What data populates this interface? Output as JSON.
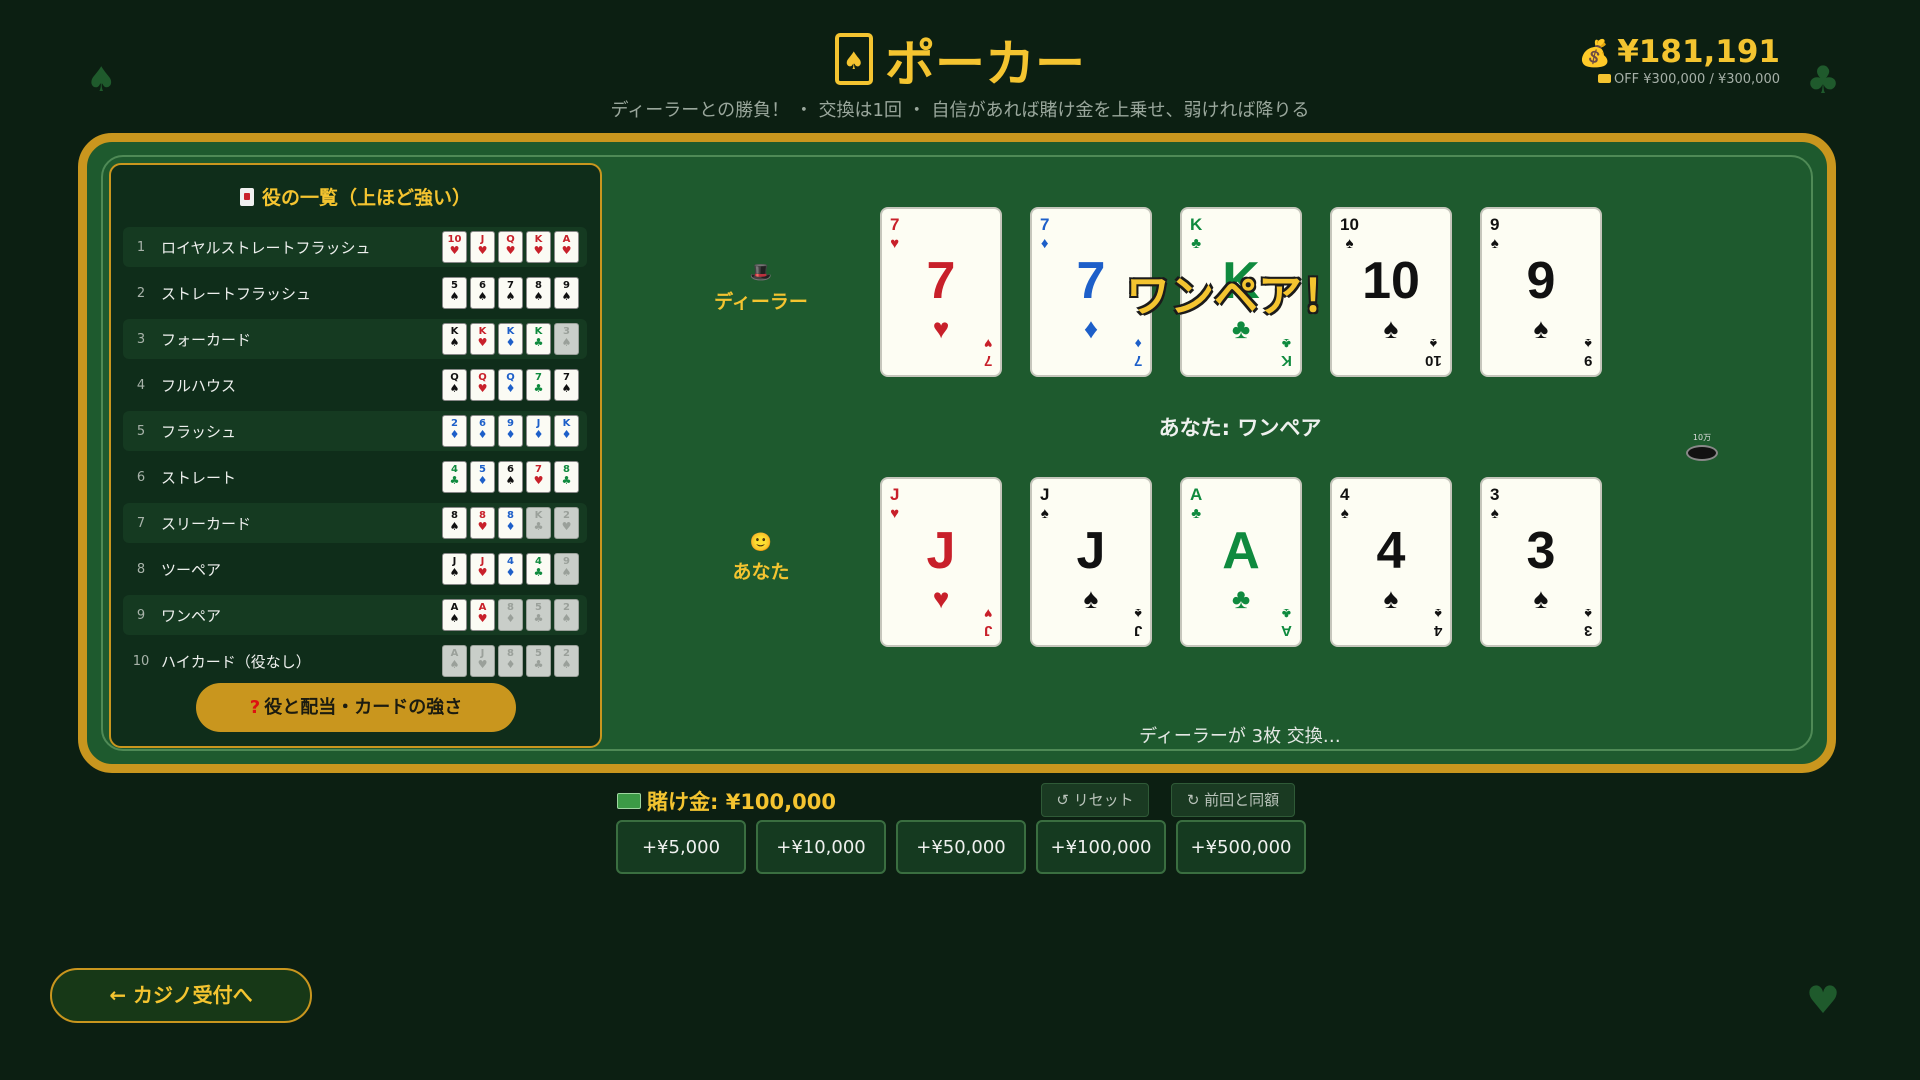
{
  "header": {
    "title": "ポーカー",
    "subtitle": "ディーラーとの勝負！ ・ 交換は1回 ・ 自信があれば賭け金を上乗せ、弱ければ降りる",
    "balance": "¥181,191",
    "limit_text": "OFF ¥300,000 / ¥300,000"
  },
  "hand_rankings": {
    "title": "役の一覧（上ほど強い）",
    "rows": [
      {
        "num": "1",
        "name": "ロイヤルストレートフラッシュ",
        "cards": [
          {
            "r": "10",
            "s": "♥",
            "c": "red"
          },
          {
            "r": "J",
            "s": "♥",
            "c": "red"
          },
          {
            "r": "Q",
            "s": "♥",
            "c": "red"
          },
          {
            "r": "K",
            "s": "♥",
            "c": "red"
          },
          {
            "r": "A",
            "s": "♥",
            "c": "red"
          }
        ]
      },
      {
        "num": "2",
        "name": "ストレートフラッシュ",
        "cards": [
          {
            "r": "5",
            "s": "♠",
            "c": "black"
          },
          {
            "r": "6",
            "s": "♠",
            "c": "black"
          },
          {
            "r": "7",
            "s": "♠",
            "c": "black"
          },
          {
            "r": "8",
            "s": "♠",
            "c": "black"
          },
          {
            "r": "9",
            "s": "♠",
            "c": "black"
          }
        ]
      },
      {
        "num": "3",
        "name": "フォーカード",
        "cards": [
          {
            "r": "K",
            "s": "♠",
            "c": "black"
          },
          {
            "r": "K",
            "s": "♥",
            "c": "red"
          },
          {
            "r": "K",
            "s": "♦",
            "c": "blue"
          },
          {
            "r": "K",
            "s": "♣",
            "c": "green"
          },
          {
            "r": "3",
            "s": "♠",
            "c": "dim"
          }
        ]
      },
      {
        "num": "4",
        "name": "フルハウス",
        "cards": [
          {
            "r": "Q",
            "s": "♠",
            "c": "black"
          },
          {
            "r": "Q",
            "s": "♥",
            "c": "red"
          },
          {
            "r": "Q",
            "s": "♦",
            "c": "blue"
          },
          {
            "r": "7",
            "s": "♣",
            "c": "green"
          },
          {
            "r": "7",
            "s": "♠",
            "c": "black"
          }
        ]
      },
      {
        "num": "5",
        "name": "フラッシュ",
        "cards": [
          {
            "r": "2",
            "s": "♦",
            "c": "blue"
          },
          {
            "r": "6",
            "s": "♦",
            "c": "blue"
          },
          {
            "r": "9",
            "s": "♦",
            "c": "blue"
          },
          {
            "r": "J",
            "s": "♦",
            "c": "blue"
          },
          {
            "r": "K",
            "s": "♦",
            "c": "blue"
          }
        ]
      },
      {
        "num": "6",
        "name": "ストレート",
        "cards": [
          {
            "r": "4",
            "s": "♣",
            "c": "green"
          },
          {
            "r": "5",
            "s": "♦",
            "c": "blue"
          },
          {
            "r": "6",
            "s": "♠",
            "c": "black"
          },
          {
            "r": "7",
            "s": "♥",
            "c": "red"
          },
          {
            "r": "8",
            "s": "♣",
            "c": "green"
          }
        ]
      },
      {
        "num": "7",
        "name": "スリーカード",
        "cards": [
          {
            "r": "8",
            "s": "♠",
            "c": "black"
          },
          {
            "r": "8",
            "s": "♥",
            "c": "red"
          },
          {
            "r": "8",
            "s": "♦",
            "c": "blue"
          },
          {
            "r": "K",
            "s": "♣",
            "c": "dim"
          },
          {
            "r": "2",
            "s": "♥",
            "c": "dim"
          }
        ]
      },
      {
        "num": "8",
        "name": "ツーペア",
        "cards": [
          {
            "r": "J",
            "s": "♠",
            "c": "black"
          },
          {
            "r": "J",
            "s": "♥",
            "c": "red"
          },
          {
            "r": "4",
            "s": "♦",
            "c": "blue"
          },
          {
            "r": "4",
            "s": "♣",
            "c": "green"
          },
          {
            "r": "9",
            "s": "♠",
            "c": "dim"
          }
        ]
      },
      {
        "num": "9",
        "name": "ワンペア",
        "cards": [
          {
            "r": "A",
            "s": "♠",
            "c": "black"
          },
          {
            "r": "A",
            "s": "♥",
            "c": "red"
          },
          {
            "r": "8",
            "s": "♦",
            "c": "dim"
          },
          {
            "r": "5",
            "s": "♣",
            "c": "dim"
          },
          {
            "r": "2",
            "s": "♠",
            "c": "dim"
          }
        ]
      },
      {
        "num": "10",
        "name": "ハイカード（役なし）",
        "cards": [
          {
            "r": "A",
            "s": "♠",
            "c": "dim"
          },
          {
            "r": "J",
            "s": "♥",
            "c": "dim"
          },
          {
            "r": "8",
            "s": "♦",
            "c": "dim"
          },
          {
            "r": "5",
            "s": "♣",
            "c": "dim"
          },
          {
            "r": "2",
            "s": "♠",
            "c": "dim"
          }
        ]
      }
    ],
    "help_button": "役と配当・カードの強さ"
  },
  "dealer": {
    "label": "ディーラー",
    "cards": [
      {
        "rank": "7",
        "suit": "♥",
        "color": "red"
      },
      {
        "rank": "7",
        "suit": "♦",
        "color": "blue"
      },
      {
        "rank": "K",
        "suit": "♣",
        "color": "green"
      },
      {
        "rank": "10",
        "suit": "♠",
        "color": "black"
      },
      {
        "rank": "9",
        "suit": "♠",
        "color": "black"
      }
    ],
    "hand_overlay": "ワンペア！"
  },
  "player": {
    "label": "あなた",
    "hand_text": "あなた: ワンペア",
    "cards": [
      {
        "rank": "J",
        "suit": "♥",
        "color": "red"
      },
      {
        "rank": "J",
        "suit": "♠",
        "color": "black"
      },
      {
        "rank": "A",
        "suit": "♣",
        "color": "green"
      },
      {
        "rank": "4",
        "suit": "♠",
        "color": "black"
      },
      {
        "rank": "3",
        "suit": "♠",
        "color": "black"
      }
    ]
  },
  "chip_label": "10万",
  "status": "ディーラーが 3枚 交換…",
  "bet": {
    "label": "賭け金: ¥100,000",
    "reset": "↺ リセット",
    "same_as_last": "↻ 前回と同額",
    "chips": [
      "+¥5,000",
      "+¥10,000",
      "+¥50,000",
      "+¥100,000",
      "+¥500,000"
    ]
  },
  "back_button": "← カジノ受付へ",
  "colors": {
    "accent": "#f4c430",
    "felt": "#1e5a2e",
    "border": "#c9961e",
    "background": "#0c1f12"
  },
  "icons": {
    "title": "card-icon",
    "balance": "money-bag-icon",
    "dealer": "top-hat-icon",
    "player": "smiley-icon",
    "help": "question-icon",
    "bet": "cash-icon"
  }
}
